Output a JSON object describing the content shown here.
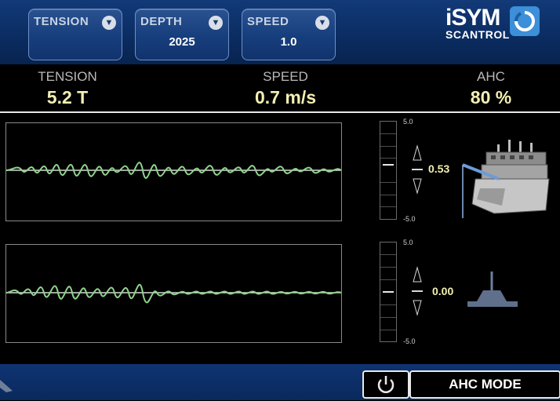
{
  "header": {
    "dropdowns": [
      {
        "label": "TENSION",
        "value": ""
      },
      {
        "label": "DEPTH",
        "value": "2025"
      },
      {
        "label": "SPEED",
        "value": "1.0"
      }
    ],
    "logo": {
      "line1": "iSYM",
      "line2": "SCANTROL"
    }
  },
  "metrics": [
    {
      "label": "TENSION",
      "value": "5.2 T"
    },
    {
      "label": "SPEED",
      "value": "0.7 m/s"
    },
    {
      "label": "AHC",
      "value": "80 %"
    }
  ],
  "panels": [
    {
      "scale_top": "5.0",
      "scale_bottom": "-5.0",
      "readout": "0.53",
      "motion_level": 0.53
    },
    {
      "scale_top": "5.0",
      "scale_bottom": "-5.0",
      "readout": "0.00",
      "motion_level": 0.0
    }
  ],
  "footer": {
    "mode_label": "AHC MODE"
  },
  "colors": {
    "accent": "#1a4387",
    "wave": "#8fd48c",
    "readout": "#f3efb2"
  }
}
